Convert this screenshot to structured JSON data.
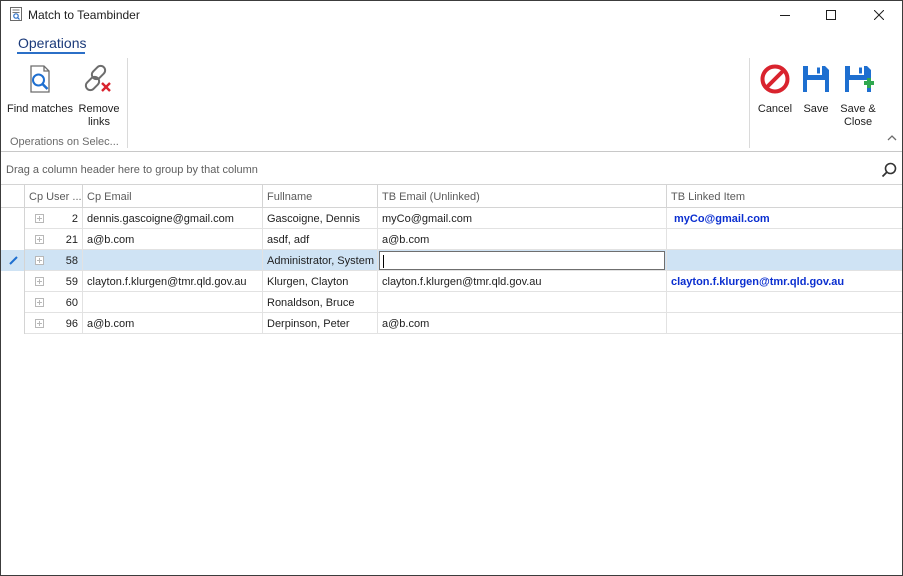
{
  "window": {
    "title": "Match to Teambinder"
  },
  "ribbon": {
    "tab": "Operations",
    "group_label": "Operations on Selec...",
    "buttons": {
      "find_matches": "Find matches",
      "remove_links": "Remove links",
      "cancel": "Cancel",
      "save": "Save",
      "save_close": "Save & Close"
    }
  },
  "grid": {
    "group_panel_hint": "Drag a column header here to group by that column",
    "columns": [
      "Cp User ...",
      "Cp Email",
      "Fullname",
      "TB Email (Unlinked)",
      "TB Linked Item"
    ],
    "rows": [
      {
        "id": "2",
        "cp_email": "dennis.gascoigne@gmail.com",
        "fullname": "Gascoigne, Dennis",
        "tb_email": "myCo@gmail.com",
        "tb_linked": "myCo@gmail.com"
      },
      {
        "id": "21",
        "cp_email": "a@b.com",
        "fullname": "asdf, adf",
        "tb_email": "a@b.com",
        "tb_linked": ""
      },
      {
        "id": "58",
        "cp_email": "",
        "fullname": "Administrator, System",
        "tb_email": "",
        "tb_linked": ""
      },
      {
        "id": "59",
        "cp_email": "clayton.f.klurgen@tmr.qld.gov.au",
        "fullname": "Klurgen, Clayton",
        "tb_email": "clayton.f.klurgen@tmr.qld.gov.au",
        "tb_linked": "clayton.f.klurgen@tmr.qld.gov.au"
      },
      {
        "id": "60",
        "cp_email": "",
        "fullname": "Ronaldson, Bruce",
        "tb_email": "",
        "tb_linked": ""
      },
      {
        "id": "96",
        "cp_email": "a@b.com",
        "fullname": "Derpinson, Peter",
        "tb_email": "a@b.com",
        "tb_linked": ""
      }
    ]
  },
  "colors": {
    "accent": "#2b6fc7",
    "selected_row": "#cfe3f4",
    "link_text": "#0b2fd0",
    "cancel_red": "#d9232e",
    "save_blue": "#1e6fd0"
  }
}
